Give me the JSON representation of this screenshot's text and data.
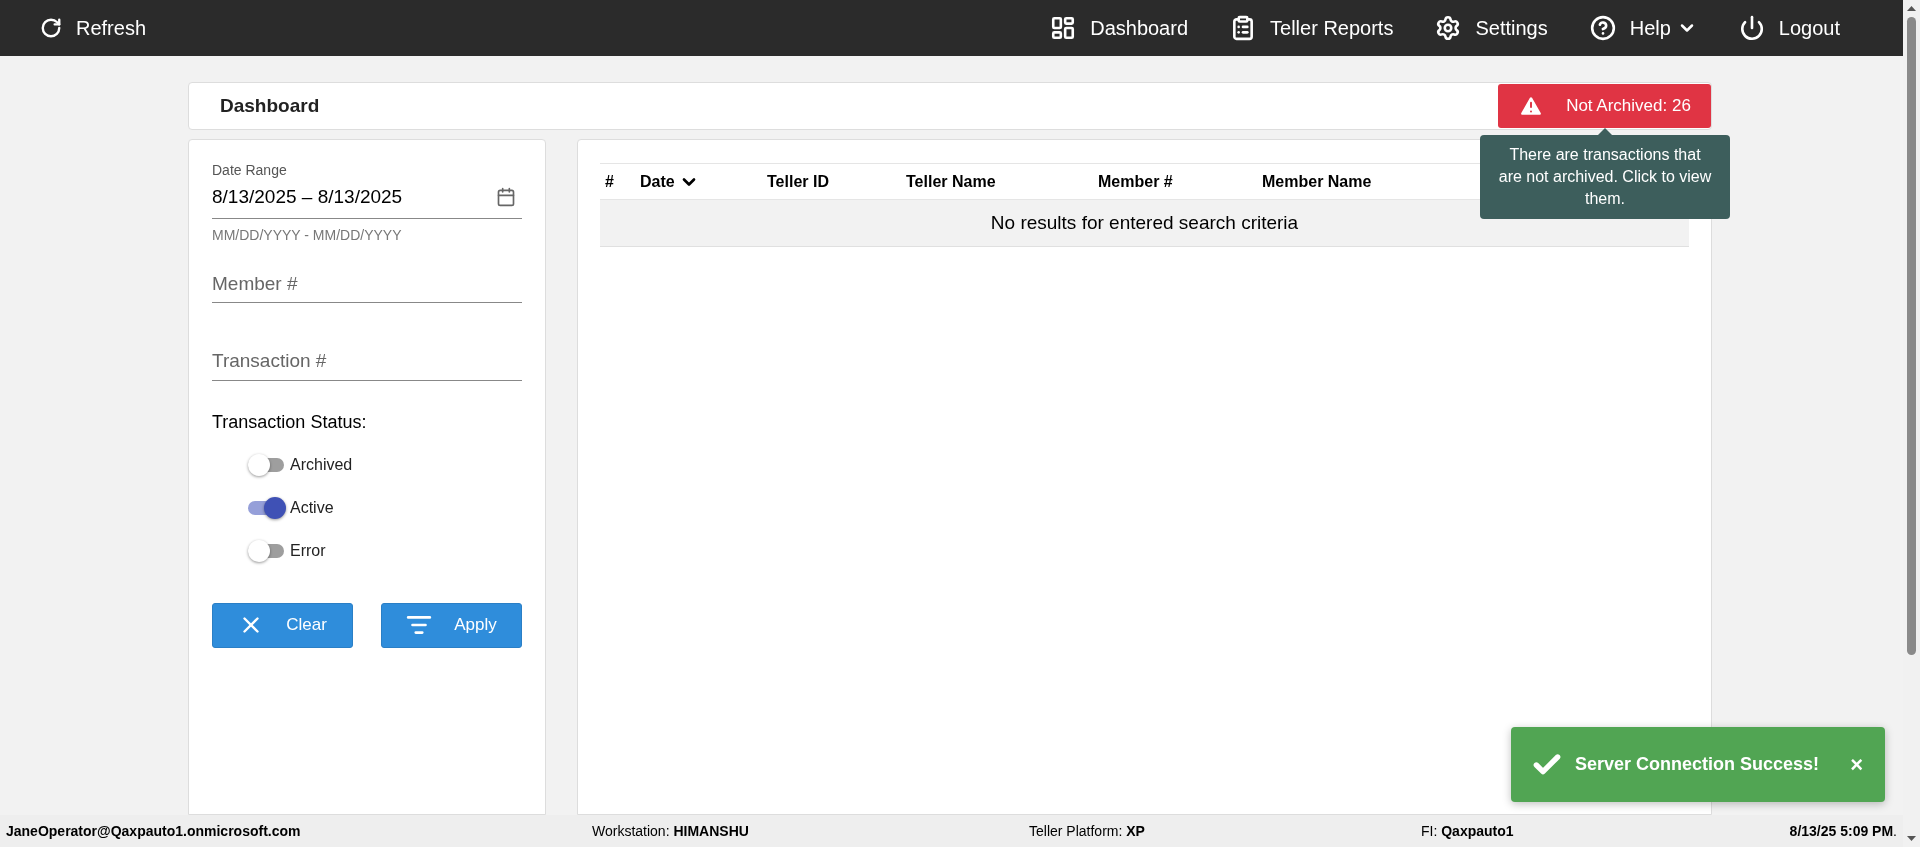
{
  "top_bar": {
    "refresh": "Refresh",
    "items": [
      {
        "label": "Dashboard",
        "dropdown": false
      },
      {
        "label": "Teller Reports",
        "dropdown": false
      },
      {
        "label": "Settings",
        "dropdown": false
      },
      {
        "label": "Help",
        "dropdown": true
      },
      {
        "label": "Logout",
        "dropdown": false
      }
    ]
  },
  "header": {
    "title": "Dashboard",
    "alert_button": "Not Archived: 26",
    "tooltip": "There are transactions that are not archived. Click to view them."
  },
  "filters": {
    "date_range": {
      "label": "Date Range",
      "value": "8/13/2025 – 8/13/2025",
      "hint": "MM/DD/YYYY - MM/DD/YYYY"
    },
    "member": {
      "placeholder": "Member #"
    },
    "transaction": {
      "placeholder": "Transaction #"
    },
    "status_label": "Transaction Status:",
    "toggles": [
      {
        "label": "Archived",
        "on": false
      },
      {
        "label": "Active",
        "on": true
      },
      {
        "label": "Error",
        "on": false
      }
    ],
    "buttons": [
      "Clear",
      "Apply"
    ]
  },
  "table": {
    "columns": [
      {
        "label": "#",
        "sorted": false
      },
      {
        "label": "Date",
        "sorted": true
      },
      {
        "label": "Teller ID",
        "sorted": false
      },
      {
        "label": "Teller Name",
        "sorted": false
      },
      {
        "label": "Member #",
        "sorted": false
      },
      {
        "label": "Member Name",
        "sorted": false
      }
    ],
    "empty_message": "No results for entered search criteria"
  },
  "toast": {
    "message": "Server Connection Success!",
    "close": "×"
  },
  "status_bar": [
    "JaneOperator@Qaxpauto1.onmicrosoft.com",
    "Workstation: **HIMANSHU**",
    "Teller Platform: **XP**",
    "FI: **Qaxpauto1**",
    "**8/13/25 5:09 PM**."
  ]
}
